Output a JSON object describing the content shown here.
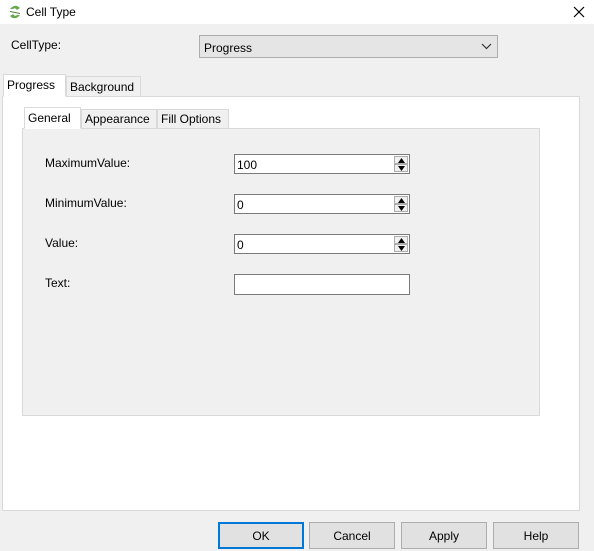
{
  "window": {
    "title": "Cell Type",
    "icon": "app-logo-icon",
    "close_icon": "close-icon"
  },
  "celltype": {
    "label": "CellType:",
    "selected": "Progress"
  },
  "outer_tabs": [
    {
      "label": "Progress",
      "active": true
    },
    {
      "label": "Background",
      "active": false
    }
  ],
  "inner_tabs": [
    {
      "label": "General",
      "active": true
    },
    {
      "label": "Appearance",
      "active": false
    },
    {
      "label": "Fill Options",
      "active": false
    }
  ],
  "fields": {
    "maximum": {
      "label": "MaximumValue:",
      "value": "100"
    },
    "minimum": {
      "label": "MinimumValue:",
      "value": "0"
    },
    "value": {
      "label": "Value:",
      "value": "0"
    },
    "text": {
      "label": "Text:",
      "value": ""
    }
  },
  "buttons": {
    "ok": "OK",
    "cancel": "Cancel",
    "apply": "Apply",
    "help": "Help"
  },
  "colors": {
    "accent": "#0078d7",
    "logo": "#6aa84f"
  }
}
